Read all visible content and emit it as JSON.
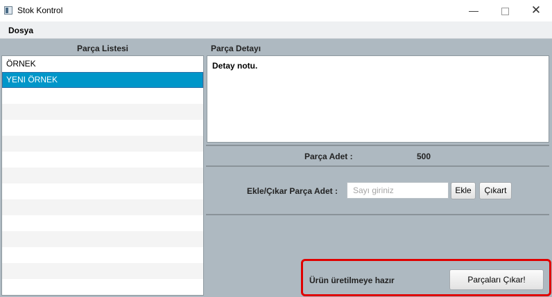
{
  "window": {
    "title": "Stok Kontrol",
    "minimize_glyph": "—",
    "close_glyph": "✕"
  },
  "menu": {
    "items": [
      "Dosya"
    ]
  },
  "left_panel": {
    "title": "Parça Listesi",
    "items": [
      "ÖRNEK",
      "YENI ÖRNEK"
    ],
    "selected_index": 1
  },
  "detail": {
    "title": "Parça Detayı",
    "note": "Detay notu."
  },
  "quantity": {
    "label": "Parça Adet :",
    "value": "500"
  },
  "adjust": {
    "label": "Ekle/Çıkar Parça Adet :",
    "input_placeholder": "Sayı giriniz",
    "input_value": "",
    "add_button": "Ekle",
    "remove_button": "Çıkart"
  },
  "production": {
    "status_text": "Ürün üretilmeye hazır",
    "button": "Parçaları Çıkar!",
    "highlight_color": "#e00000"
  },
  "colors": {
    "panel_background": "#aeb9c1",
    "selection": "#0096c9"
  }
}
